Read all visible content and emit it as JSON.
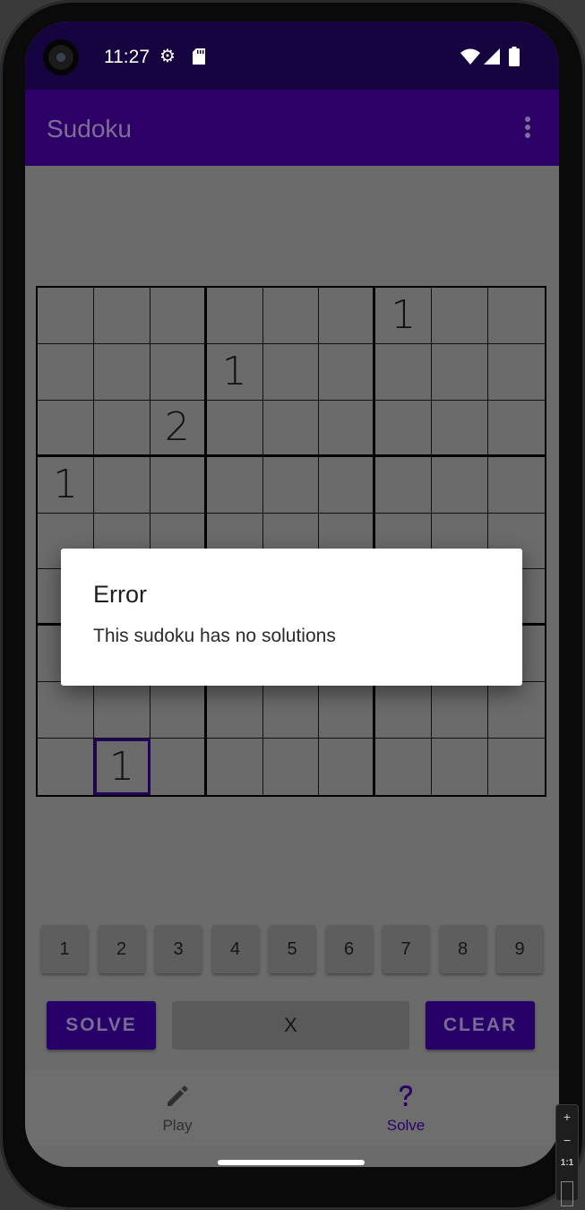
{
  "status_bar": {
    "time": "11:27",
    "icons": [
      "gear-icon",
      "sd-card-icon",
      "wifi-icon",
      "signal-icon",
      "battery-icon"
    ]
  },
  "app_bar": {
    "title": "Sudoku",
    "menu_icon": "more-vert-icon"
  },
  "board": {
    "rows": [
      [
        "",
        "",
        "",
        "",
        "",
        "",
        "1",
        "",
        ""
      ],
      [
        "",
        "",
        "",
        "1",
        "",
        "",
        "",
        "",
        ""
      ],
      [
        "",
        "",
        "2",
        "",
        "",
        "",
        "",
        "",
        ""
      ],
      [
        "1",
        "",
        "",
        "",
        "",
        "",
        "",
        "",
        ""
      ],
      [
        "",
        "",
        "",
        "",
        "",
        "",
        "",
        "",
        ""
      ],
      [
        "",
        "",
        "",
        "",
        "",
        "",
        "",
        "",
        ""
      ],
      [
        "",
        "",
        "",
        "",
        "",
        "",
        "",
        "",
        ""
      ],
      [
        "",
        "",
        "",
        "",
        "",
        "",
        "",
        "",
        ""
      ],
      [
        "",
        "1",
        "",
        "",
        "",
        "",
        "",
        "",
        ""
      ]
    ],
    "selected_cell": [
      8,
      1
    ]
  },
  "numpad": {
    "keys": [
      "1",
      "2",
      "3",
      "4",
      "5",
      "6",
      "7",
      "8",
      "9"
    ]
  },
  "actions": {
    "solve_label": "SOLVE",
    "erase_label": "X",
    "clear_label": "CLEAR"
  },
  "bottom_nav": {
    "play": {
      "label": "Play",
      "icon": "pencil-icon"
    },
    "solve": {
      "label": "Solve",
      "icon": "question-icon"
    }
  },
  "dialog": {
    "title": "Error",
    "message": "This sudoku has no solutions"
  },
  "emulator_controls": {
    "zoom_in": "+",
    "zoom_out": "−",
    "actual_size": "1:1"
  },
  "colors": {
    "status_bar": "#15043f",
    "app_bar": "#2c0066",
    "accent": "#280069",
    "scrim_background": "#6b6b6b",
    "dialog_background": "#ffffff"
  }
}
